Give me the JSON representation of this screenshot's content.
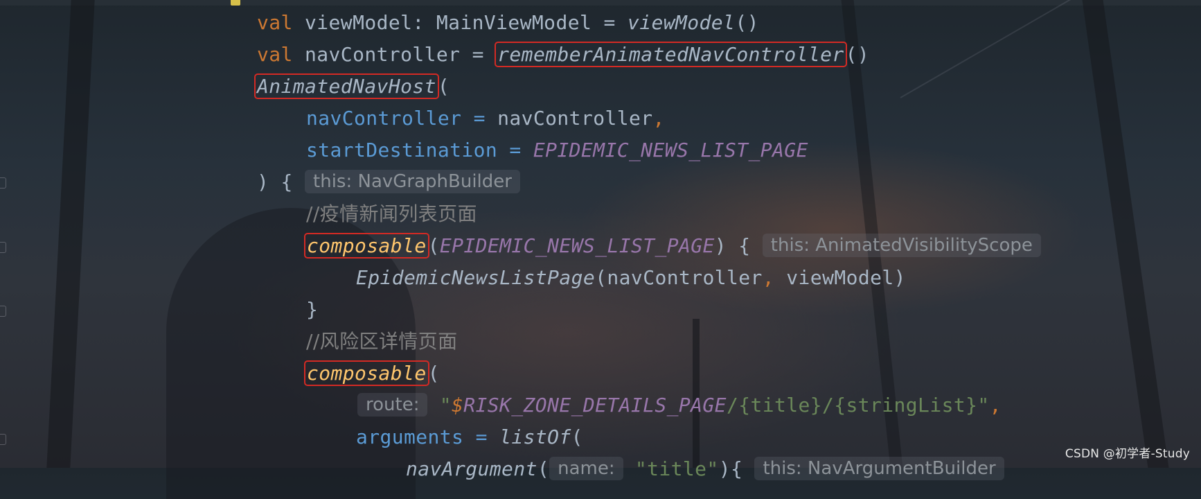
{
  "code": {
    "line1": {
      "kw": "val",
      "name": " viewModel: MainViewModel = ",
      "call": "viewModel",
      "tail": "()"
    },
    "line2": {
      "kw": "val",
      "name": " navController = ",
      "call": "rememberAnimatedNavController",
      "tail": "()"
    },
    "line3": {
      "call": "AnimatedNavHost",
      "tail": "("
    },
    "line4": {
      "param": "navController",
      "eq": " = ",
      "value": "navController",
      "comma": ","
    },
    "line5": {
      "param": "startDestination",
      "eq": " = ",
      "const": "EPIDEMIC_NEWS_LIST_PAGE"
    },
    "line6": {
      "text": ") { ",
      "hint": "this: NavGraphBuilder"
    },
    "line7": {
      "comment": "//疫情新闻列表页面"
    },
    "line8": {
      "call": "composable",
      "open": "(",
      "const": "EPIDEMIC_NEWS_LIST_PAGE",
      "close": ") { ",
      "hint": "this: AnimatedVisibilityScope"
    },
    "line9": {
      "call": "EpidemicNewsListPage",
      "open": "(",
      "arg1": "navController",
      "comma": ", ",
      "arg2": "viewModel",
      "close": ")"
    },
    "line10": {
      "text": "}"
    },
    "line11": {
      "comment": "//风险区详情页面"
    },
    "line12": {
      "call": "composable",
      "open": "("
    },
    "line13": {
      "hint": "route:",
      "quote": "\"",
      "tmpl": "$",
      "const": "RISK_ZONE_DETAILS_PAGE",
      "str": "/{title}/{stringList}",
      "quote2": "\"",
      "comma": ","
    },
    "line14": {
      "param": "arguments",
      "eq": " = ",
      "call": "listOf",
      "open": "("
    },
    "line15": {
      "call": "navArgument",
      "open": "(",
      "hint": "name:",
      "str": "\"title\"",
      "close": "){ ",
      "hint2": "this: NavArgumentBuilder"
    }
  },
  "watermark": "CSDN @初学者-Study",
  "colors": {
    "keyword": "#cc7832",
    "parameter": "#5b9bd5",
    "constant": "#9876aa",
    "composable": "#ffc66d",
    "string": "#6a8759",
    "highlight_box": "#d42a24"
  }
}
